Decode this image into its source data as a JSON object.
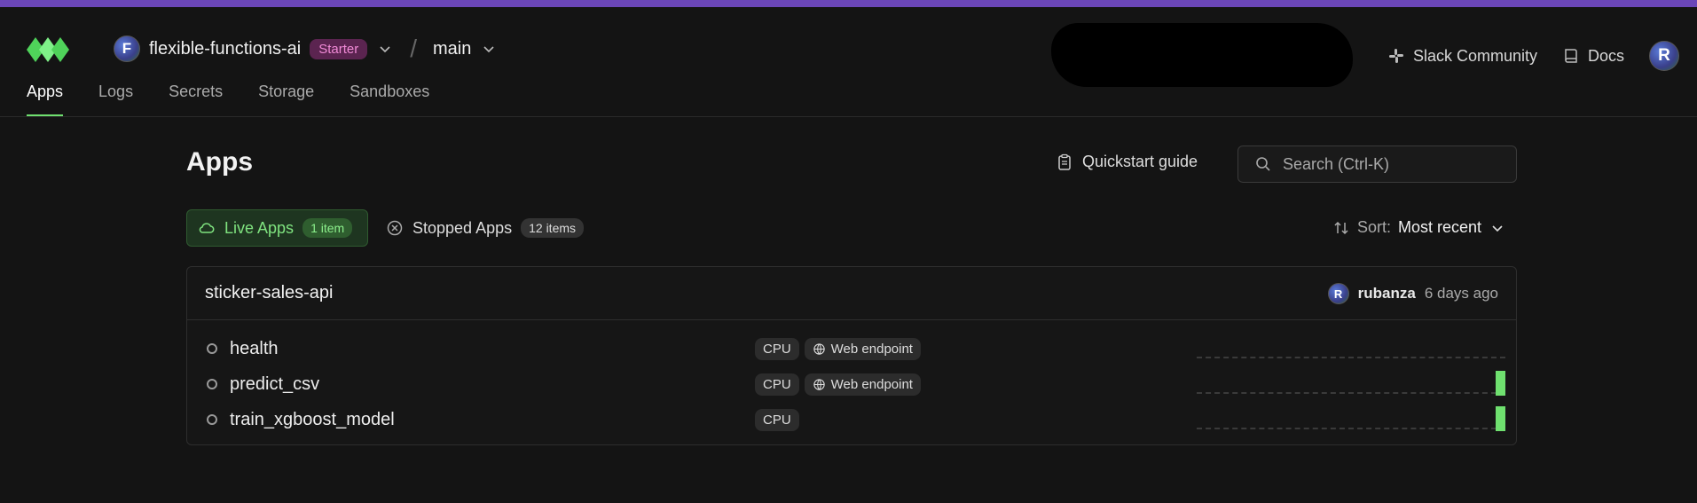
{
  "workspace": {
    "initial": "F",
    "name": "flexible-functions-ai",
    "plan": "Starter",
    "environment": "main"
  },
  "top_links": {
    "slack": "Slack Community",
    "docs": "Docs",
    "user_initial": "R"
  },
  "tabs": [
    {
      "label": "Apps",
      "active": true
    },
    {
      "label": "Logs",
      "active": false
    },
    {
      "label": "Secrets",
      "active": false
    },
    {
      "label": "Storage",
      "active": false
    },
    {
      "label": "Sandboxes",
      "active": false
    }
  ],
  "page": {
    "title": "Apps",
    "quickstart": "Quickstart guide",
    "search_placeholder": "Search (Ctrl-K)"
  },
  "filters": {
    "live_label": "Live Apps",
    "live_count": "1 item",
    "stopped_label": "Stopped Apps",
    "stopped_count": "12 items"
  },
  "sort": {
    "label": "Sort:",
    "value": "Most recent"
  },
  "app": {
    "name": "sticker-sales-api",
    "owner_initial": "R",
    "owner": "rubanza",
    "updated": "6 days ago",
    "functions": [
      {
        "name": "health",
        "tags": [
          "CPU",
          "Web endpoint"
        ],
        "recent_activity": false
      },
      {
        "name": "predict_csv",
        "tags": [
          "CPU",
          "Web endpoint"
        ],
        "recent_activity": true
      },
      {
        "name": "train_xgboost_model",
        "tags": [
          "CPU"
        ],
        "recent_activity": true
      }
    ]
  },
  "colors": {
    "accent_stripe": "#6b46b8",
    "live_green": "#6fe06f",
    "plan_badge": "#5b2450"
  }
}
